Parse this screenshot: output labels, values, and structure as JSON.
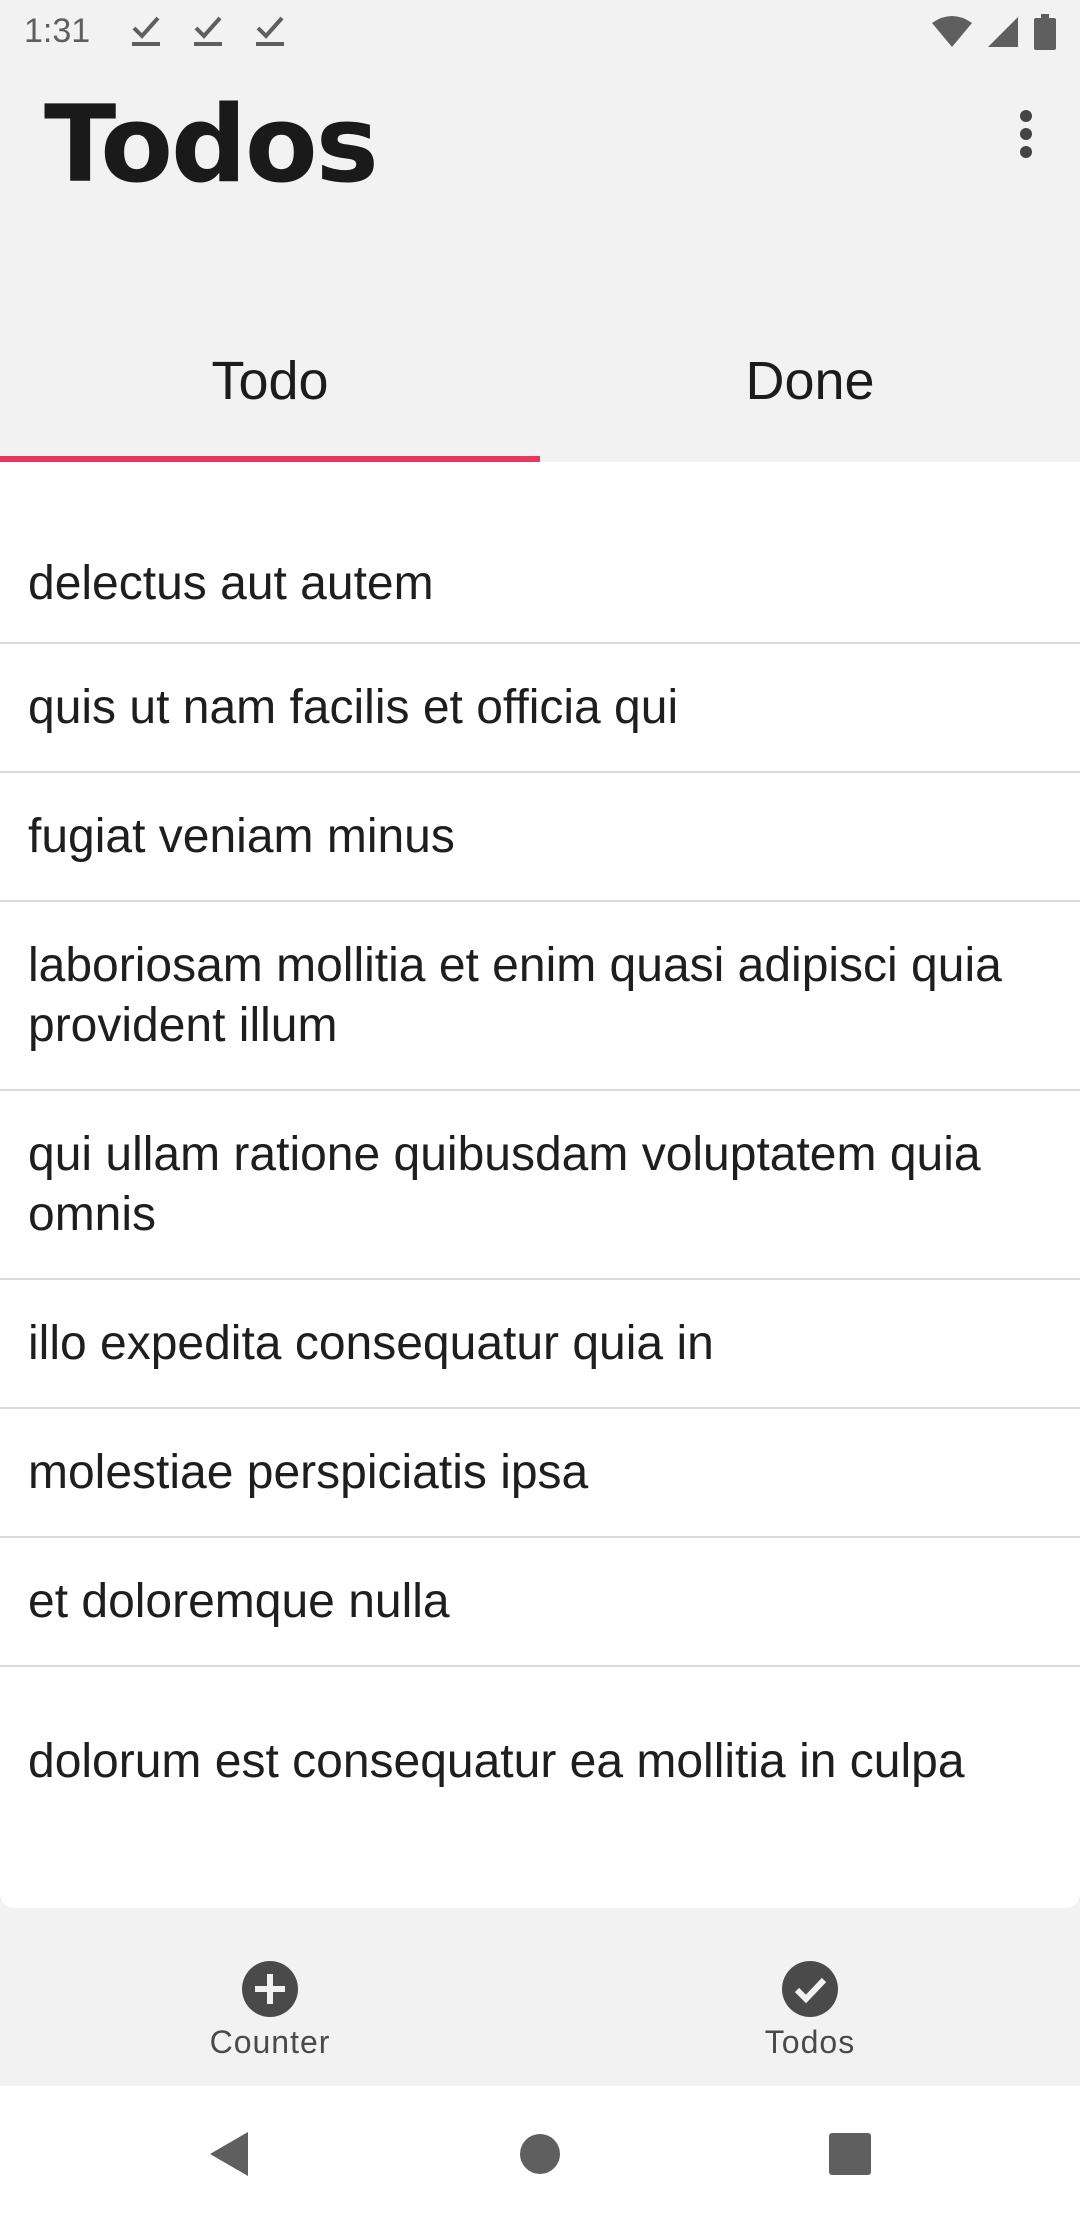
{
  "status_bar": {
    "time": "1:31",
    "notification_icons": [
      "check-icon",
      "check-icon",
      "check-icon"
    ],
    "right_icons": [
      "wifi-icon",
      "cell-signal-icon",
      "battery-icon"
    ]
  },
  "header": {
    "title": "Todos",
    "menu_icon": "more-vert-icon"
  },
  "tabs": [
    {
      "label": "Todo",
      "active": true
    },
    {
      "label": "Done",
      "active": false
    }
  ],
  "accent_color": "#e8375f",
  "todos": [
    "delectus aut autem",
    "quis ut nam facilis et officia qui",
    "fugiat veniam minus",
    "laboriosam mollitia et enim quasi adipisci quia provident illum",
    "qui ullam ratione quibusdam voluptatem quia omnis",
    "illo expedita consequatur quia in",
    "molestiae perspiciatis ipsa",
    "et doloremque nulla",
    "dolorum est consequatur ea mollitia in culpa"
  ],
  "bottom_nav": [
    {
      "label": "Counter",
      "icon": "add-circle-icon"
    },
    {
      "label": "Todos",
      "icon": "check-circle-icon"
    }
  ],
  "system_nav": [
    "back-icon",
    "home-icon",
    "recents-icon"
  ]
}
